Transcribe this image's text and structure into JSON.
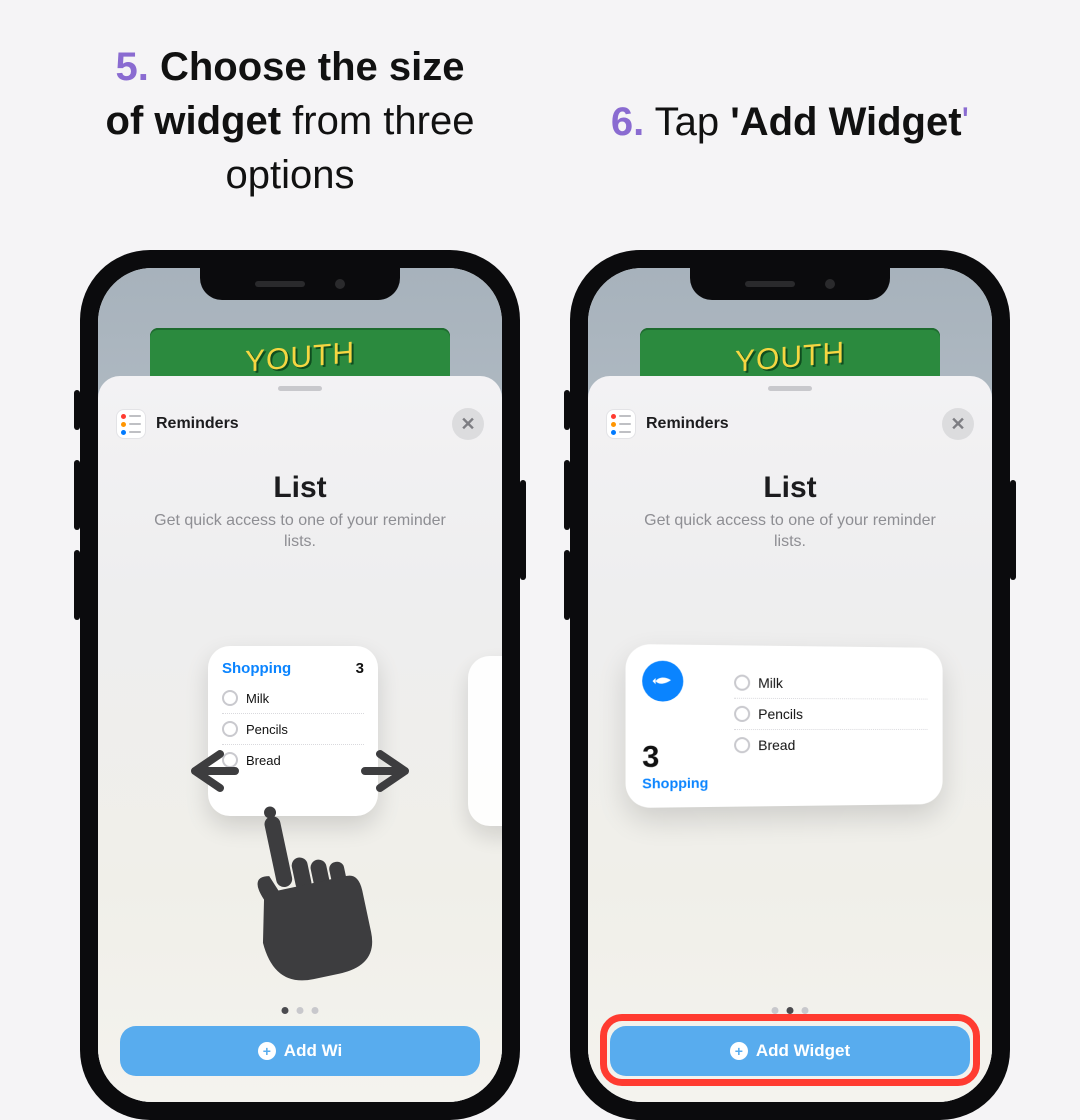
{
  "steps": {
    "five": {
      "num": "5.",
      "bold_a": "Choose the size",
      "bold_b_prefix": "of  ",
      "bold_b": "widget",
      "rest_a": " from three",
      "rest_b": "options"
    },
    "six": {
      "num": "6.",
      "plain": " Tap ",
      "quote": "'",
      "bold": "Add Widget"
    }
  },
  "banner": "YOUTH",
  "sheet": {
    "app_name": "Reminders",
    "title": "List",
    "subtitle": "Get quick access to one of your reminder lists.",
    "add_label_full": "Add Widget",
    "add_label_trunc": "Add Wi"
  },
  "widget": {
    "name": "Shopping",
    "count": "3",
    "items": [
      "Milk",
      "Pencils",
      "Bread"
    ]
  }
}
